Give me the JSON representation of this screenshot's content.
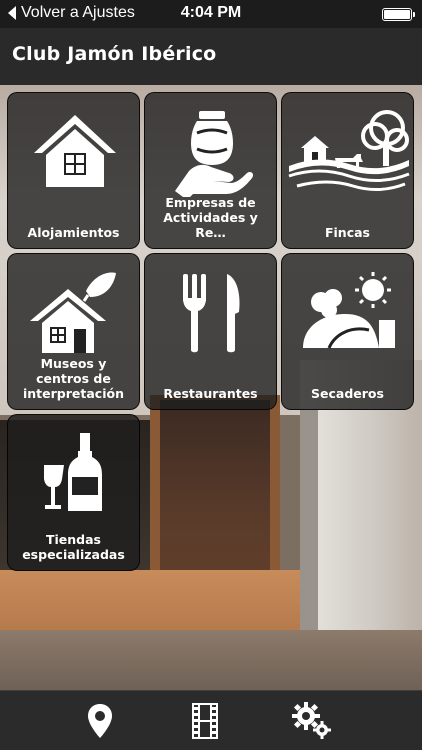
{
  "status_bar": {
    "back_label": "Volver a Ajustes",
    "time": "4:04 PM",
    "battery_level": 1.0
  },
  "header": {
    "title": "Club Jamón Ibérico"
  },
  "tiles": [
    {
      "label": "Alojamientos",
      "icon": "house-icon"
    },
    {
      "label": "Empresas de Actividades y Re…",
      "icon": "jar-hand-icon"
    },
    {
      "label": "Fincas",
      "icon": "farm-icon"
    },
    {
      "label": "Museos y centros de interpretación",
      "icon": "house-leaf-icon"
    },
    {
      "label": "Restaurantes",
      "icon": "fork-knife-icon"
    },
    {
      "label": "Secaderos",
      "icon": "hill-sun-icon"
    },
    {
      "label": "Tiendas especializadas",
      "icon": "wine-bottle-glass-icon"
    }
  ],
  "tab_bar": {
    "items": [
      {
        "icon": "map-pin-icon"
      },
      {
        "icon": "film-icon"
      },
      {
        "icon": "gears-icon"
      }
    ]
  },
  "colors": {
    "tile_background": "#1e1e1e",
    "header_background": "#2a2a2a",
    "tab_bar_background": "#2b2b2b",
    "icon_color": "#ffffff"
  }
}
